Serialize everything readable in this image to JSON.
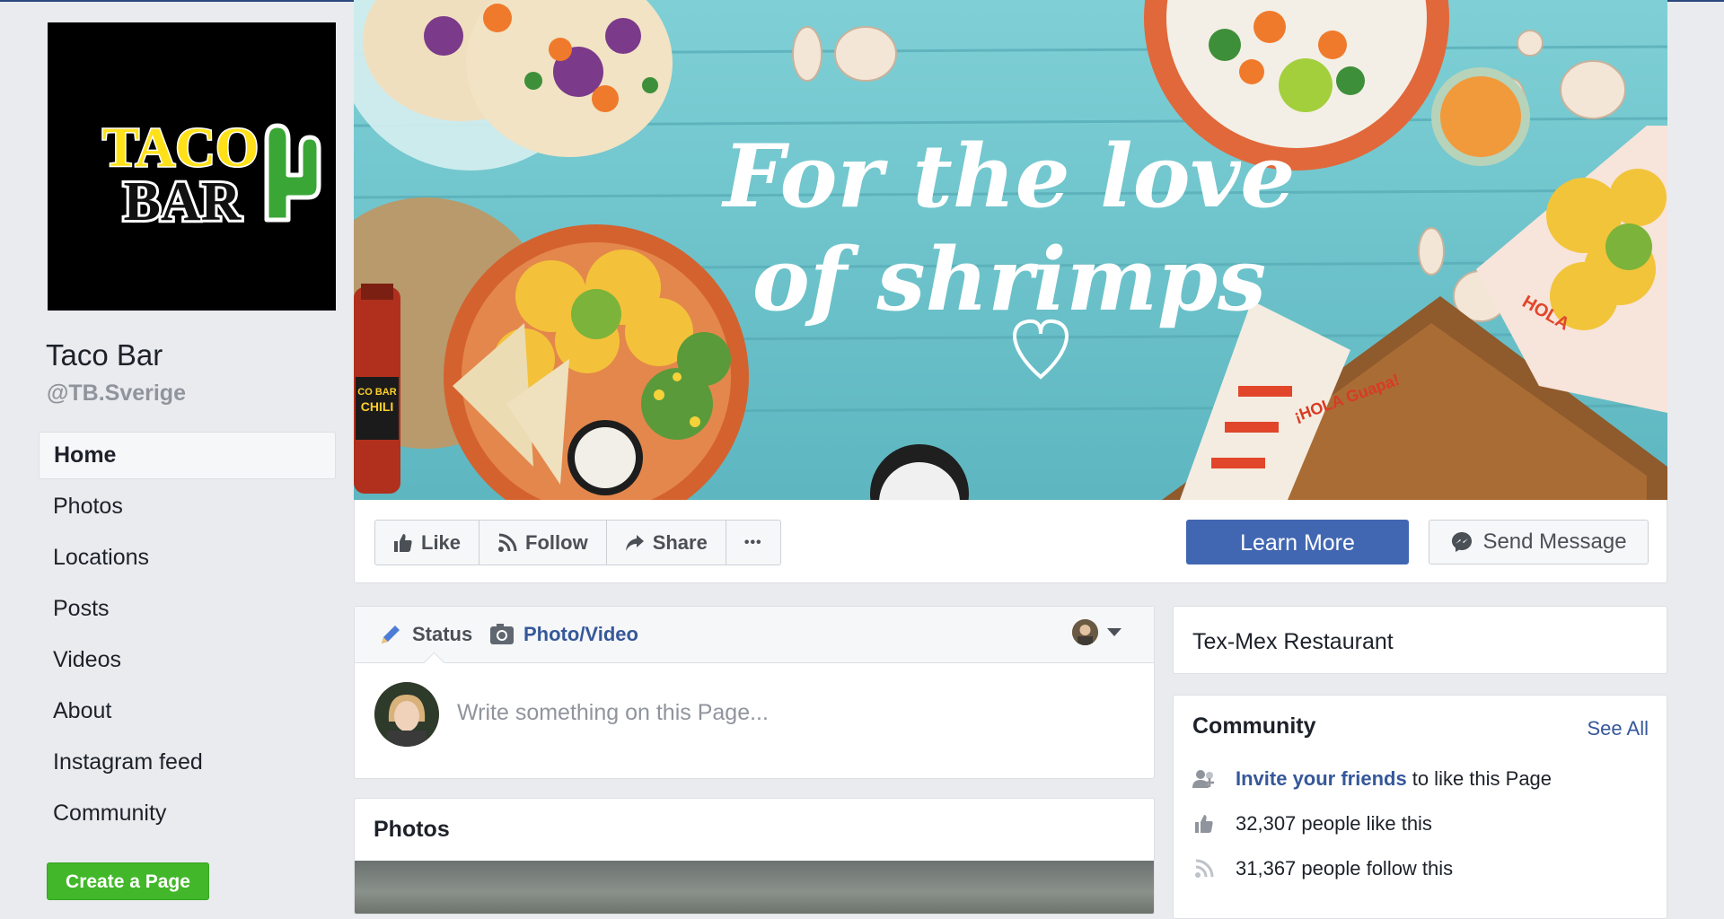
{
  "page": {
    "name": "Taco Bar",
    "handle": "@TB.Sverige",
    "logo_text_line1": "TACO",
    "logo_text_line2": "BAR"
  },
  "sidebar": {
    "items": [
      {
        "label": "Home",
        "active": true
      },
      {
        "label": "Photos"
      },
      {
        "label": "Locations"
      },
      {
        "label": "Posts"
      },
      {
        "label": "Videos"
      },
      {
        "label": "About"
      },
      {
        "label": "Instagram feed"
      },
      {
        "label": "Community"
      }
    ],
    "create_page_label": "Create a Page"
  },
  "cover": {
    "headline_line1": "For the love",
    "headline_line2": "of shrimps",
    "bottle_label": "CO BAR",
    "bottle_label2": "CHILI",
    "wrap_label": "¡HOLA Guapa!",
    "basket_label": "HOLA"
  },
  "actions": {
    "like_label": "Like",
    "follow_label": "Follow",
    "share_label": "Share",
    "more_label": "•••",
    "learn_more_label": "Learn More",
    "send_message_label": "Send Message"
  },
  "composer": {
    "status_label": "Status",
    "photo_video_label": "Photo/Video",
    "placeholder": "Write something on this Page..."
  },
  "photos": {
    "title": "Photos"
  },
  "about": {
    "category": "Tex-Mex Restaurant"
  },
  "community": {
    "title": "Community",
    "see_all": "See All",
    "invite_link": "Invite your friends",
    "invite_rest": "to like this Page",
    "likes_text": "32,307 people like this",
    "follows_text": "31,367 people follow this"
  },
  "colors": {
    "fb_blue": "#4267b2",
    "link_blue": "#365899",
    "green": "#42b72a",
    "background": "#e9ebee",
    "cover_wood": "#6cc3cb"
  },
  "icons": [
    "thumbs-up-icon",
    "rss-icon",
    "share-arrow-icon",
    "more-dots-icon",
    "messenger-icon",
    "pencil-icon",
    "camera-icon",
    "people-icon",
    "caret-down-icon"
  ]
}
